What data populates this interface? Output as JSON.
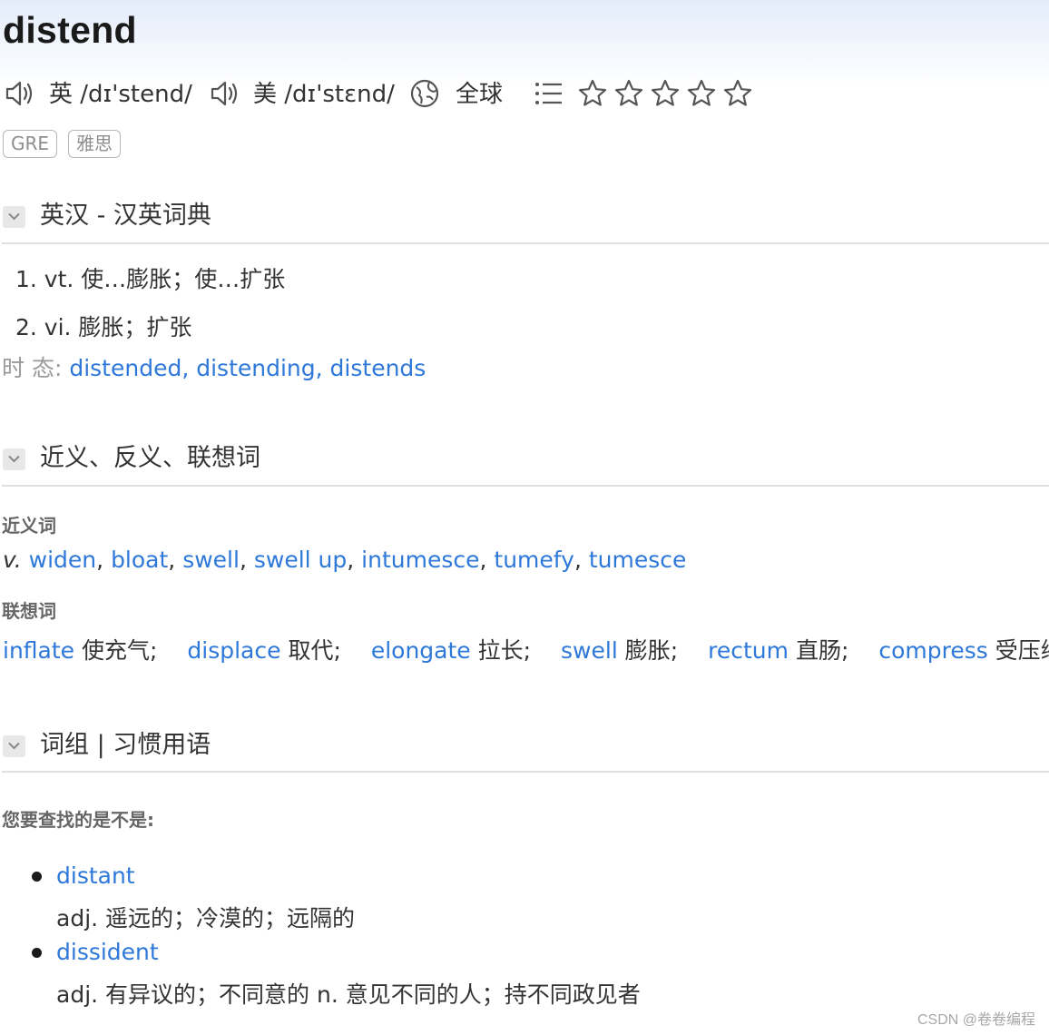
{
  "word": "distend",
  "pronunciations": [
    {
      "region": "英",
      "ipa": "/dɪ'stend/"
    },
    {
      "region": "美",
      "ipa": "/dɪ'stɛnd/"
    }
  ],
  "global_label": "全球",
  "rating_stars": 5,
  "rating_filled": 0,
  "tags": [
    "GRE",
    "雅思"
  ],
  "sections": {
    "dict_title": "英汉 - 汉英词典",
    "synonyms_title": "近义、反义、联想词",
    "phrases_title": "词组 | 习惯用语"
  },
  "definitions": [
    "1. vt. 使…膨胀；使…扩张",
    "2. vi. 膨胀；扩张"
  ],
  "tense": {
    "label": "时 态:",
    "forms": [
      "distended",
      "distending",
      "distends"
    ]
  },
  "synonyms": {
    "label": "近义词",
    "pos": "v.",
    "words": [
      "widen",
      "bloat",
      "swell",
      "swell up",
      "intumesce",
      "tumefy",
      "tumesce"
    ]
  },
  "associations": {
    "label": "联想词",
    "items": [
      {
        "word": "inflate",
        "meaning": "使充气;"
      },
      {
        "word": "displace",
        "meaning": "取代;"
      },
      {
        "word": "elongate",
        "meaning": "拉长;"
      },
      {
        "word": "swell",
        "meaning": "膨胀;"
      },
      {
        "word": "rectum",
        "meaning": "直肠;"
      },
      {
        "word": "compress",
        "meaning": "受压缩小;"
      }
    ]
  },
  "did_you_mean": {
    "label": "您要查找的是不是:",
    "items": [
      {
        "word": "distant",
        "def": "adj. 遥远的；冷漠的；远隔的"
      },
      {
        "word": "dissident",
        "def": "adj. 有异议的；不同意的 n. 意见不同的人；持不同政见者"
      }
    ]
  },
  "watermark": "CSDN @卷卷编程",
  "colors": {
    "link": "#2e78d9",
    "text": "#333333",
    "muted": "#9a9a9a"
  }
}
